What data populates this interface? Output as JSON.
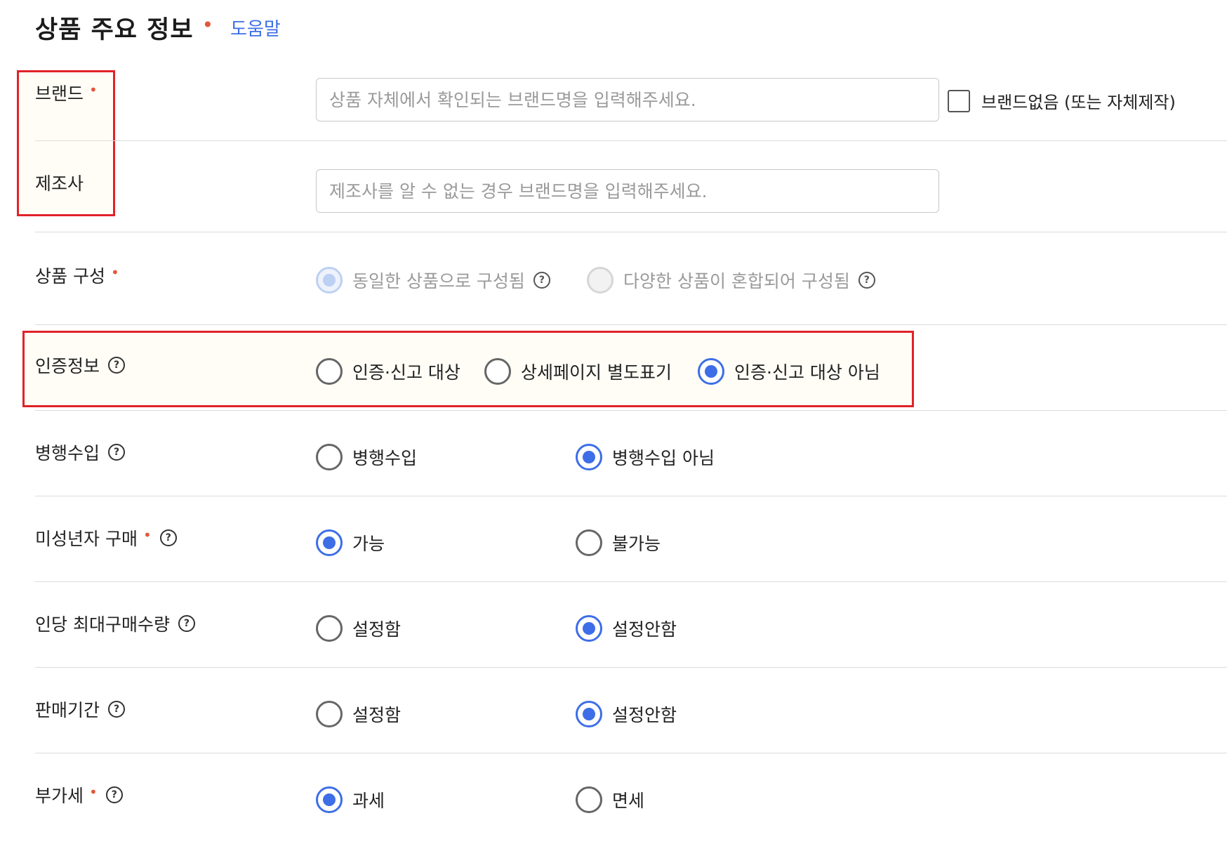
{
  "section": {
    "title": "상품 주요 정보",
    "required_mark": "•",
    "help_link": "도움말"
  },
  "brand": {
    "label": "브랜드",
    "required_mark": "•",
    "placeholder": "상품 자체에서 확인되는 브랜드명을 입력해주세요.",
    "checkbox_label": "브랜드없음 (또는 자체제작)",
    "checkbox_checked": false
  },
  "manufacturer": {
    "label": "제조사",
    "placeholder": "제조사를 알 수 없는 경우 브랜드명을 입력해주세요."
  },
  "composition": {
    "label": "상품 구성",
    "required_mark": "•",
    "options": [
      {
        "label": "동일한 상품으로 구성됨",
        "state": "disabled-checked",
        "help_icon": "?"
      },
      {
        "label": "다양한 상품이 혼합되어 구성됨",
        "state": "disabled",
        "help_icon": "?"
      }
    ]
  },
  "certification": {
    "label": "인증정보",
    "help_icon": "?",
    "options": [
      {
        "label": "인증·신고 대상",
        "checked": false
      },
      {
        "label": "상세페이지 별도표기",
        "checked": false
      },
      {
        "label": "인증·신고 대상 아님",
        "checked": true
      }
    ]
  },
  "parallel_import": {
    "label": "병행수입",
    "help_icon": "?",
    "options": [
      {
        "label": "병행수입",
        "checked": false
      },
      {
        "label": "병행수입 아님",
        "checked": true
      }
    ]
  },
  "minor_purchase": {
    "label": "미성년자 구매",
    "required_mark": "•",
    "help_icon": "?",
    "options": [
      {
        "label": "가능",
        "checked": true
      },
      {
        "label": "불가능",
        "checked": false
      }
    ]
  },
  "max_purchase": {
    "label": "인당 최대구매수량",
    "help_icon": "?",
    "options": [
      {
        "label": "설정함",
        "checked": false
      },
      {
        "label": "설정안함",
        "checked": true
      }
    ]
  },
  "sales_period": {
    "label": "판매기간",
    "help_icon": "?",
    "options": [
      {
        "label": "설정함",
        "checked": false
      },
      {
        "label": "설정안함",
        "checked": true
      }
    ]
  },
  "vat": {
    "label": "부가세",
    "required_mark": "•",
    "help_icon": "?",
    "options": [
      {
        "label": "과세",
        "checked": true
      },
      {
        "label": "면세",
        "checked": false
      }
    ]
  },
  "colors": {
    "accent": "#3d6ee8",
    "required": "#e2573b",
    "highlight_border": "#e12228"
  }
}
